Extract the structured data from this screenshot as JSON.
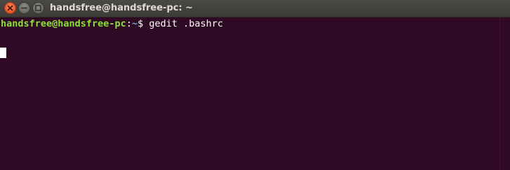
{
  "window": {
    "title": "handsfree@handsfree-pc: ~",
    "buttons": {
      "close_icon": "close-icon",
      "minimize_icon": "minimize-icon",
      "maximize_icon": "maximize-icon"
    }
  },
  "terminal": {
    "prompt_user_host": "handsfree@handsfree-pc",
    "prompt_sep": ":",
    "prompt_path": "~",
    "prompt_symbol": "$ ",
    "command": "gedit .bashrc"
  },
  "colors": {
    "background": "#300a24",
    "prompt_user": "#8ae234",
    "prompt_path": "#729fcf",
    "text": "#ffffff",
    "titlebar": "#3c3b37",
    "close_button": "#df4a16"
  }
}
